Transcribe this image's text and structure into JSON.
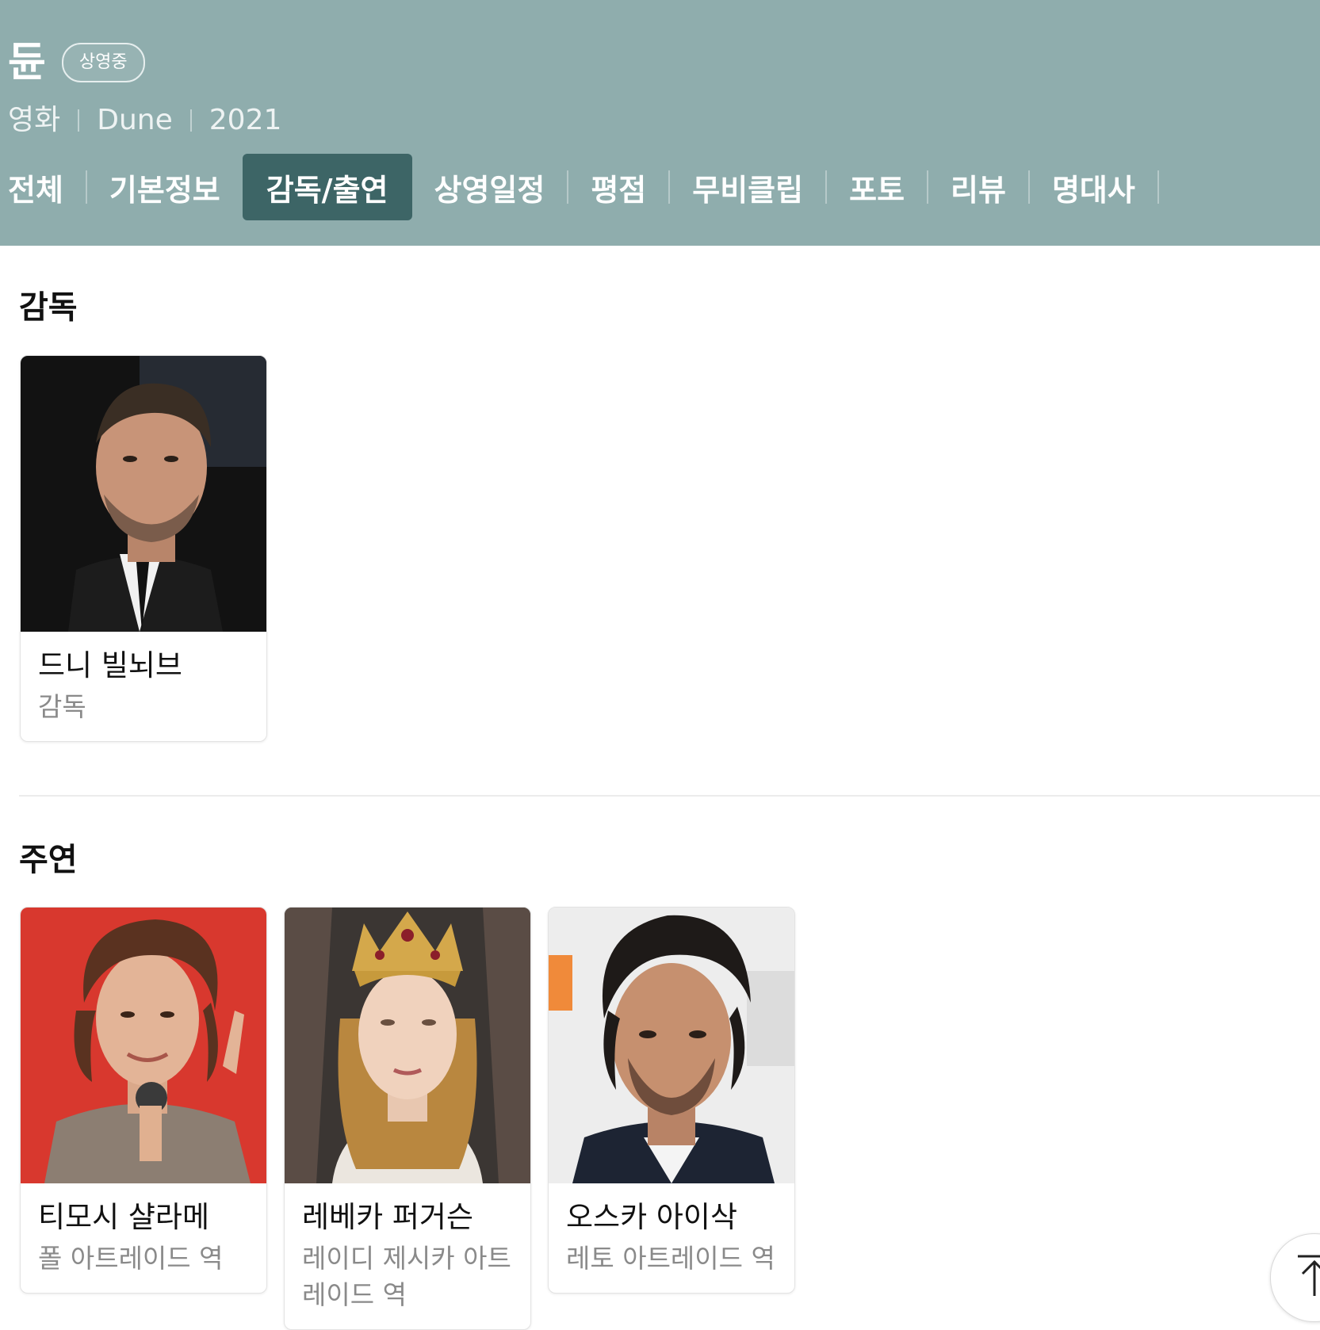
{
  "header": {
    "title": "듄",
    "badge": "상영중",
    "meta": [
      "영화",
      "Dune",
      "2021"
    ],
    "background_color": "#8fadad",
    "active_tab_color": "#3d6566"
  },
  "tabs": [
    {
      "label": "전체",
      "active": false
    },
    {
      "label": "기본정보",
      "active": false
    },
    {
      "label": "감독/출연",
      "active": true
    },
    {
      "label": "상영일정",
      "active": false
    },
    {
      "label": "평점",
      "active": false
    },
    {
      "label": "무비클립",
      "active": false
    },
    {
      "label": "포토",
      "active": false
    },
    {
      "label": "리뷰",
      "active": false
    },
    {
      "label": "명대사",
      "active": false
    }
  ],
  "director_section": {
    "title": "감독",
    "people": [
      {
        "name": "드니 빌뇌브",
        "role": "감독"
      }
    ]
  },
  "cast_section": {
    "title": "주연",
    "people": [
      {
        "name": "티모시 샬라메",
        "role": "폴 아트레이드 역"
      },
      {
        "name": "레베카 퍼거슨",
        "role": "레이디 제시카 아트레이드 역"
      },
      {
        "name": "오스카 아이삭",
        "role": "레토 아트레이드 역"
      }
    ]
  },
  "scroll_top": {
    "icon": "arrow-up-to-top-icon"
  }
}
